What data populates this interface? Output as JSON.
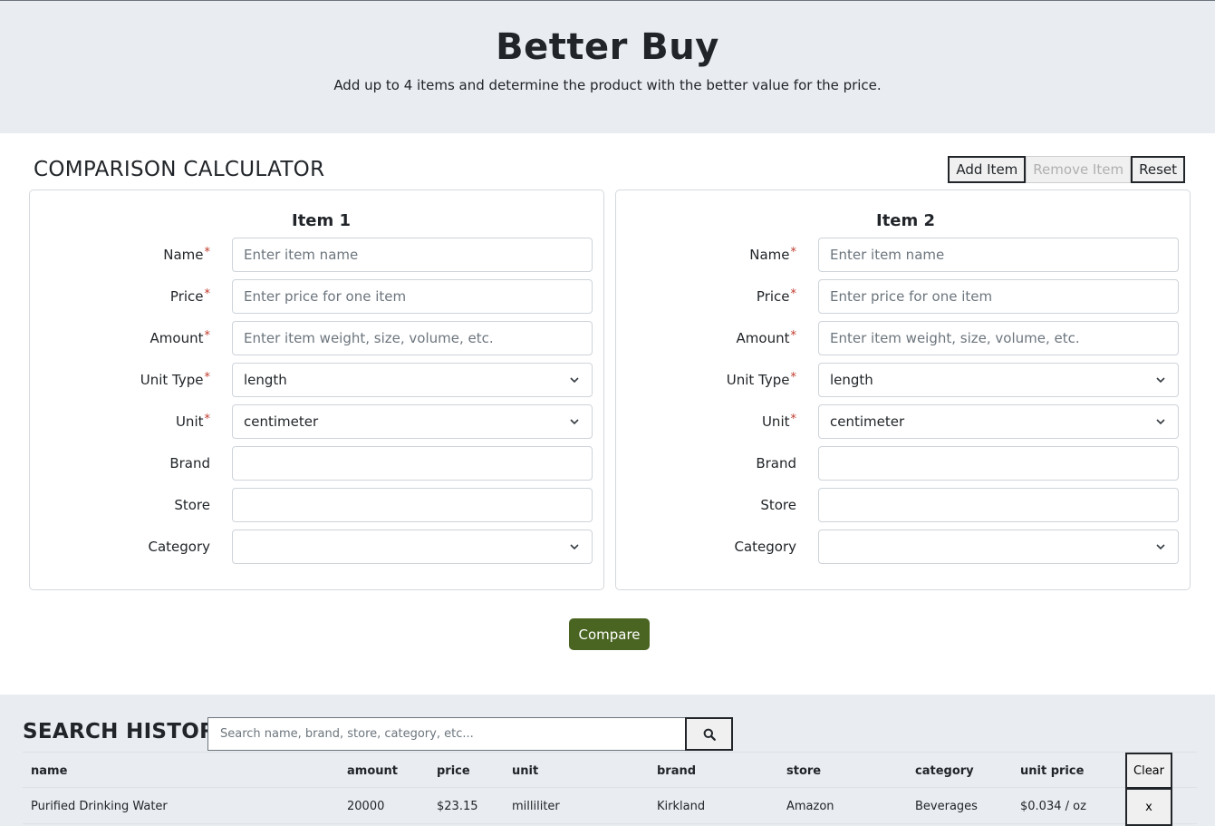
{
  "header": {
    "title": "Better Buy",
    "subtitle": "Add up to 4 items and determine the product with the better value for the price."
  },
  "calculator": {
    "title": "COMPARISON CALCULATOR",
    "add_label": "Add Item",
    "remove_label": "Remove Item",
    "reset_label": "Reset",
    "required_mark": "*",
    "items": [
      {
        "heading": "Item 1",
        "labels": {
          "name": "Name",
          "price": "Price",
          "amount": "Amount",
          "unit_type": "Unit Type",
          "unit": "Unit",
          "brand": "Brand",
          "store": "Store",
          "category": "Category"
        },
        "placeholders": {
          "name": "Enter item name",
          "price": "Enter price for one item",
          "amount": "Enter item weight, size, volume, etc."
        },
        "values": {
          "unit_type": "length",
          "unit": "centimeter",
          "brand": "",
          "store": "",
          "category": ""
        }
      },
      {
        "heading": "Item 2",
        "labels": {
          "name": "Name",
          "price": "Price",
          "amount": "Amount",
          "unit_type": "Unit Type",
          "unit": "Unit",
          "brand": "Brand",
          "store": "Store",
          "category": "Category"
        },
        "placeholders": {
          "name": "Enter item name",
          "price": "Enter price for one item",
          "amount": "Enter item weight, size, volume, etc."
        },
        "values": {
          "unit_type": "length",
          "unit": "centimeter",
          "brand": "",
          "store": "",
          "category": ""
        }
      }
    ],
    "compare_label": "Compare"
  },
  "history": {
    "title": "SEARCH HISTORY",
    "search_placeholder": "Search name, brand, store, category, etc...",
    "columns": [
      "name",
      "amount",
      "price",
      "unit",
      "brand",
      "store",
      "category",
      "unit price"
    ],
    "clear_label": "Clear",
    "rows": [
      {
        "name": "Purified Drinking Water",
        "amount": "20000",
        "price": "$23.15",
        "unit": "milliliter",
        "brand": "Kirkland",
        "store": "Amazon",
        "category": "Beverages",
        "unit_price": "$0.034 / oz",
        "delete_label": "x"
      }
    ]
  },
  "colors": {
    "accent": "#4a6422",
    "panel_bg": "#e9edf1"
  }
}
